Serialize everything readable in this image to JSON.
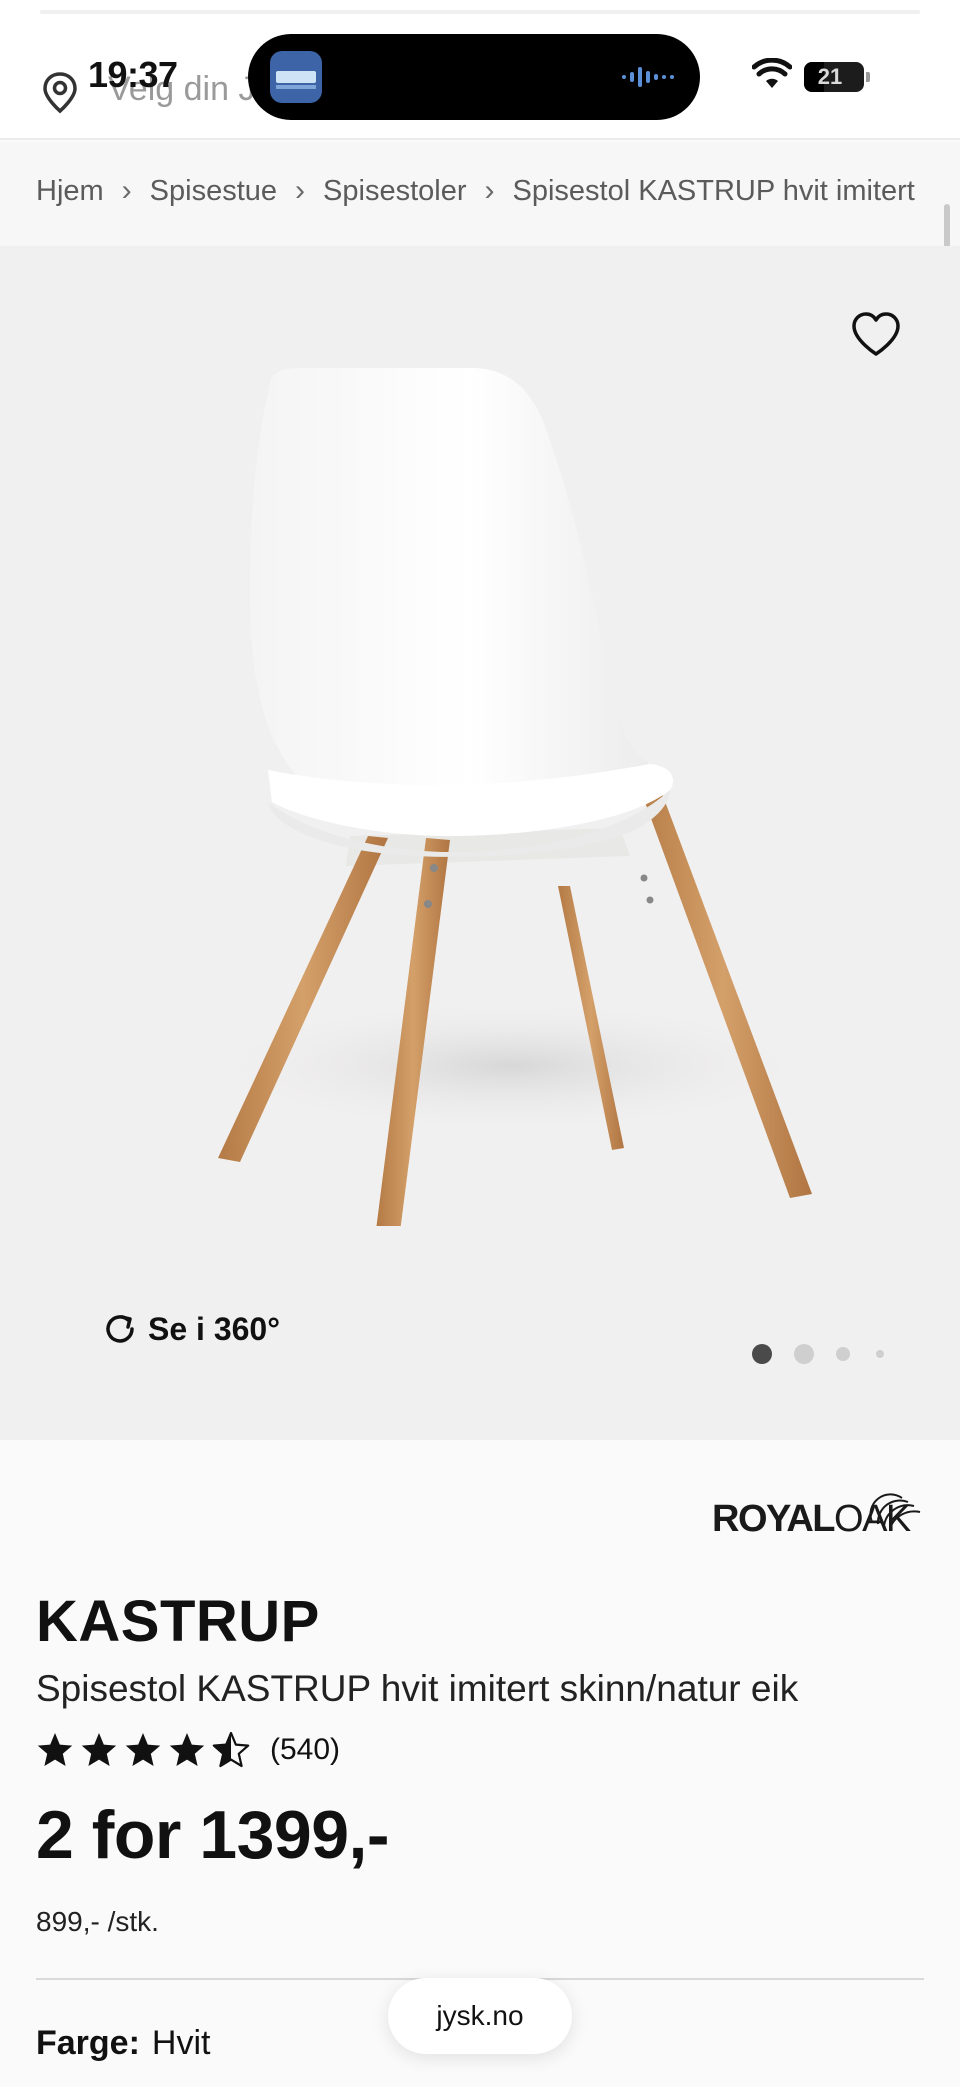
{
  "status_bar": {
    "time": "19:37",
    "battery_level": "21",
    "now_playing_app": "photo-app-thumbnail"
  },
  "header": {
    "location_placeholder": "Velg din J"
  },
  "breadcrumb": {
    "items": [
      {
        "label": "Hjem"
      },
      {
        "label": "Spisestue"
      },
      {
        "label": "Spisestoler"
      },
      {
        "label": "Spisestol KASTRUP hvit imitert"
      }
    ],
    "separator": "›"
  },
  "gallery": {
    "view_360_label": "Se i 360°",
    "slide_count": 4,
    "active_slide": 1
  },
  "product": {
    "brand": {
      "part1": "ROYAL",
      "part2": "OAK"
    },
    "name": "KASTRUP",
    "description": "Spisestol KASTRUP hvit imitert skinn/natur eik",
    "rating": {
      "stars": 4.5,
      "max": 5,
      "count_label": "(540)"
    },
    "price": "2 for 1399,-",
    "unit_price": "899,- /stk.",
    "color": {
      "label": "Farge:",
      "value": "Hvit"
    }
  },
  "browser": {
    "url": "jysk.no"
  },
  "colors": {
    "accent": "#111111",
    "gallery_bg": "#f1f0f0",
    "wood": "#c9925a",
    "chair_shell": "#ffffff"
  }
}
